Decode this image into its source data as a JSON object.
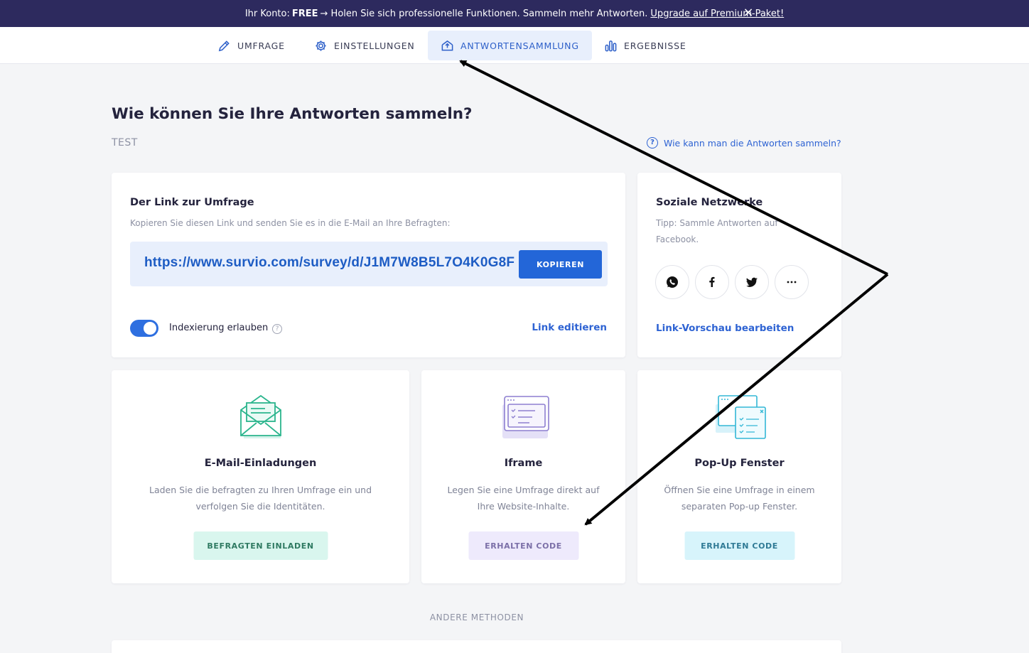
{
  "banner": {
    "prefix": "Ihr Konto:",
    "plan": "FREE",
    "message": "→ Holen Sie sich professionelle Funktionen. Sammeln mehr Antworten.",
    "upgrade_link": "Upgrade auf Premium-Paket!",
    "close_icon": "×"
  },
  "nav": {
    "tabs": [
      {
        "label": "UMFRAGE",
        "icon": "pencil-icon"
      },
      {
        "label": "EINSTELLUNGEN",
        "icon": "gear-icon"
      },
      {
        "label": "ANTWORTENSAMMLUNG",
        "icon": "share-icon",
        "active": true
      },
      {
        "label": "ERGEBNISSE",
        "icon": "bar-chart-icon"
      }
    ]
  },
  "page": {
    "title": "Wie können Sie Ihre Antworten sammeln?",
    "survey_name": "TEST",
    "help_link": "Wie kann man die Antworten sammeln?"
  },
  "link_card": {
    "title": "Der Link zur Umfrage",
    "description": "Kopieren Sie diesen Link und senden Sie es in die E-Mail an Ihre Befragten:",
    "url": "https://www.survio.com/survey/d/J1M7W8B5L7O4K0G8F",
    "copy_button": "KOPIEREN",
    "toggle_label": "Indexierung erlauben",
    "toggle_on": true,
    "edit_link": "Link editieren"
  },
  "social_card": {
    "title": "Soziale Netzwerke",
    "tip": "Tipp: Sammle Antworten auf Facebook.",
    "networks": [
      "whatsapp-icon",
      "facebook-icon",
      "twitter-icon",
      "more-icon"
    ],
    "preview_link": "Link-Vorschau bearbeiten"
  },
  "methods": [
    {
      "title": "E-Mail-Einladungen",
      "description": "Laden Sie die befragten zu Ihren Umfrage ein und verfolgen Sie die Identitäten.",
      "button": "BEFRAGTEN EINLADEN",
      "icon": "envelope-icon"
    },
    {
      "title": "Iframe",
      "description": "Legen Sie eine Umfrage direkt auf Ihre Website-Inhalte.",
      "button": "ERHALTEN CODE",
      "icon": "iframe-icon"
    },
    {
      "title": "Pop-Up Fenster",
      "description": "Öffnen Sie eine Umfrage in einem separaten Pop-up Fenster.",
      "button": "ERHALTEN CODE",
      "icon": "popup-window-icon"
    }
  ],
  "other_methods": "ANDERE METHODEN",
  "colors": {
    "banner_bg": "#2d2a5e",
    "accent": "#2366d8",
    "page_bg": "#f4f5f7"
  }
}
